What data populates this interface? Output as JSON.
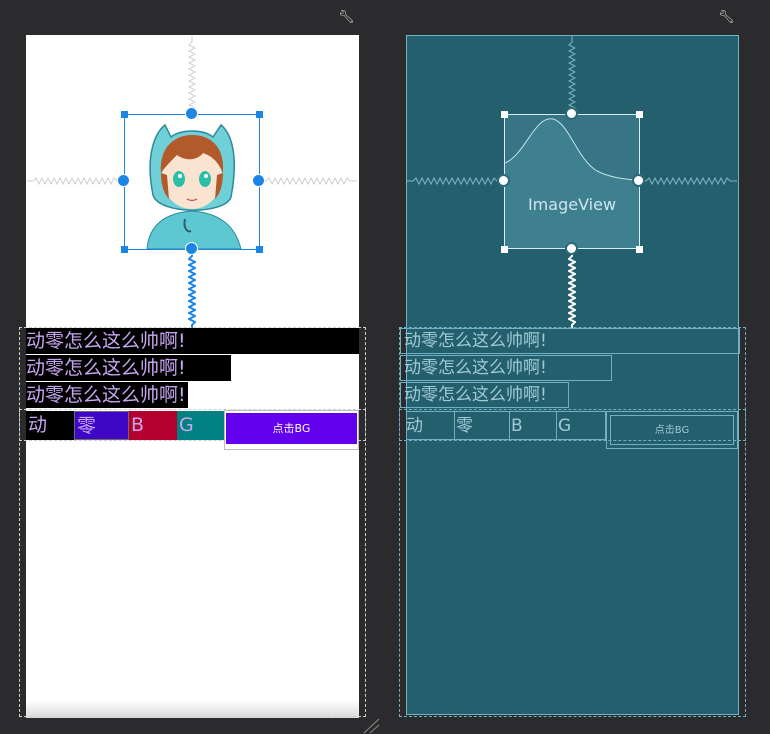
{
  "design_view": {
    "textviews": [
      "动零怎么这么帅啊!",
      "动零怎么这么帅啊!",
      "动零怎么这么帅啊!"
    ],
    "row_cells": [
      "动",
      "零",
      "B",
      "G"
    ],
    "button_label": "点击BG",
    "image": "anime-boy-in-blue-hoodie"
  },
  "blueprint_view": {
    "textviews": [
      "动零怎么这么帅啊!",
      "动零怎么这么帅啊!",
      "动零怎么这么帅啊!"
    ],
    "row_cells": [
      "动",
      "零",
      "B",
      "G"
    ],
    "button_label": "点击BG",
    "imageview_label": "ImageView"
  },
  "toolbar": {
    "left_icon": "wrench-icon",
    "right_icon": "wrench-icon"
  },
  "colors": {
    "textview_bg": "#000000",
    "textview_text": "#c7a6ef",
    "cell_2_bg": "#3f06c5",
    "cell_3_bg": "#b3002e",
    "cell_4_bg": "#008080",
    "button_bg": "#6200ee",
    "blueprint_bg": "#245f6e",
    "selection": "#1c86e8"
  }
}
